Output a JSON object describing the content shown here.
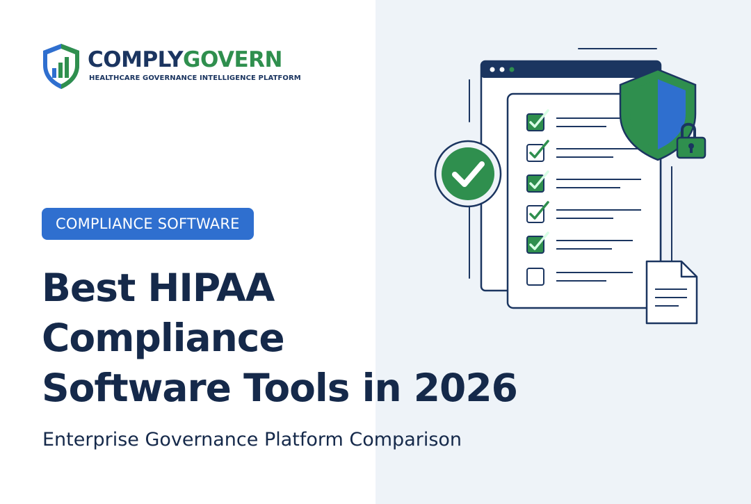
{
  "brand": {
    "name_part1": "COMPLY",
    "name_part2": "GOVERN",
    "tagline": "HEALTHCARE GOVERNANCE INTELLIGENCE PLATFORM",
    "colors": {
      "navy": "#1b3560",
      "green": "#2f8f4e",
      "blue": "#2f6fcf"
    },
    "logo_icon": "shield-bar-chart-icon"
  },
  "badge": {
    "label": "COMPLIANCE SOFTWARE"
  },
  "headline": {
    "line1": "Best HIPAA",
    "line2": "Compliance",
    "line3": "Software Tools in 2026"
  },
  "subheadline": "Enterprise Governance Platform Comparison",
  "illustration": {
    "icons": [
      "browser-window-icon",
      "checklist-icon",
      "check-circle-icon",
      "security-shield-icon",
      "padlock-icon",
      "document-icon"
    ],
    "checklist_checked": [
      true,
      true,
      true,
      true,
      true,
      false
    ]
  }
}
